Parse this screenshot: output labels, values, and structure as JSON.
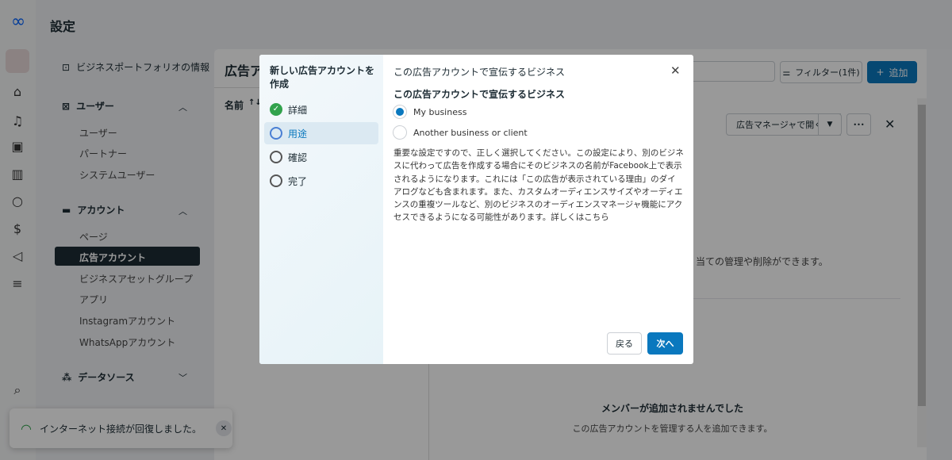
{
  "app": {
    "title": "設定"
  },
  "nav": {
    "business_info": "ビジネスポートフォリオの情報",
    "users_head": "ユーザー",
    "users": [
      "ユーザー",
      "パートナー",
      "システムユーザー"
    ],
    "accounts_head": "アカウント",
    "accounts": [
      "ページ",
      "広告アカウント",
      "ビジネスアセットグループ",
      "アプリ",
      "Instagramアカウント",
      "WhatsAppアカウント"
    ],
    "data_sources_head": "データソース"
  },
  "main": {
    "title": "広告ア",
    "column_name": "名前",
    "sort_icon": "↑↓",
    "filter_label": "フィルター(1件)",
    "add_label": "追加",
    "open_ads_manager": "広告マネージャで開く",
    "more": "•••",
    "permission_text": "当ての管理や削除ができます。",
    "empty_title": "メンバーが追加されませんでした",
    "empty_desc": "この広告アカウントを管理する人を追加できます。"
  },
  "modal": {
    "left_title": "新しい広告アカウントを作成",
    "steps": [
      {
        "label": "詳細",
        "state": "done"
      },
      {
        "label": "用途",
        "state": "current"
      },
      {
        "label": "確認",
        "state": "todo"
      },
      {
        "label": "完了",
        "state": "todo"
      }
    ],
    "header": "この広告アカウントで宣伝するビジネス",
    "section_title": "この広告アカウントで宣伝するビジネス",
    "options": [
      {
        "label": "My business",
        "selected": true
      },
      {
        "label": "Another business or client",
        "selected": false
      }
    ],
    "description": "重要な設定ですので、正しく選択してください。この設定により、別のビジネスに代わって広告を作成する場合にそのビジネスの名前がFacebook上で表示されるようになります。これには「この広告が表示されている理由」のダイアログなども含まれます。また、カスタムオーディエンスサイズやオーディエンスの重複ツールなど、別のビジネスのオーディエンスマネージャ機能にアクセスできるようになる可能性があります。詳しくはこちら",
    "back": "戻る",
    "next": "次へ"
  },
  "toast": {
    "message": "インターネット接続が回復しました。"
  },
  "colors": {
    "accent": "#0a78be",
    "success": "#31a24c",
    "nav_active": "#1c2b33"
  }
}
